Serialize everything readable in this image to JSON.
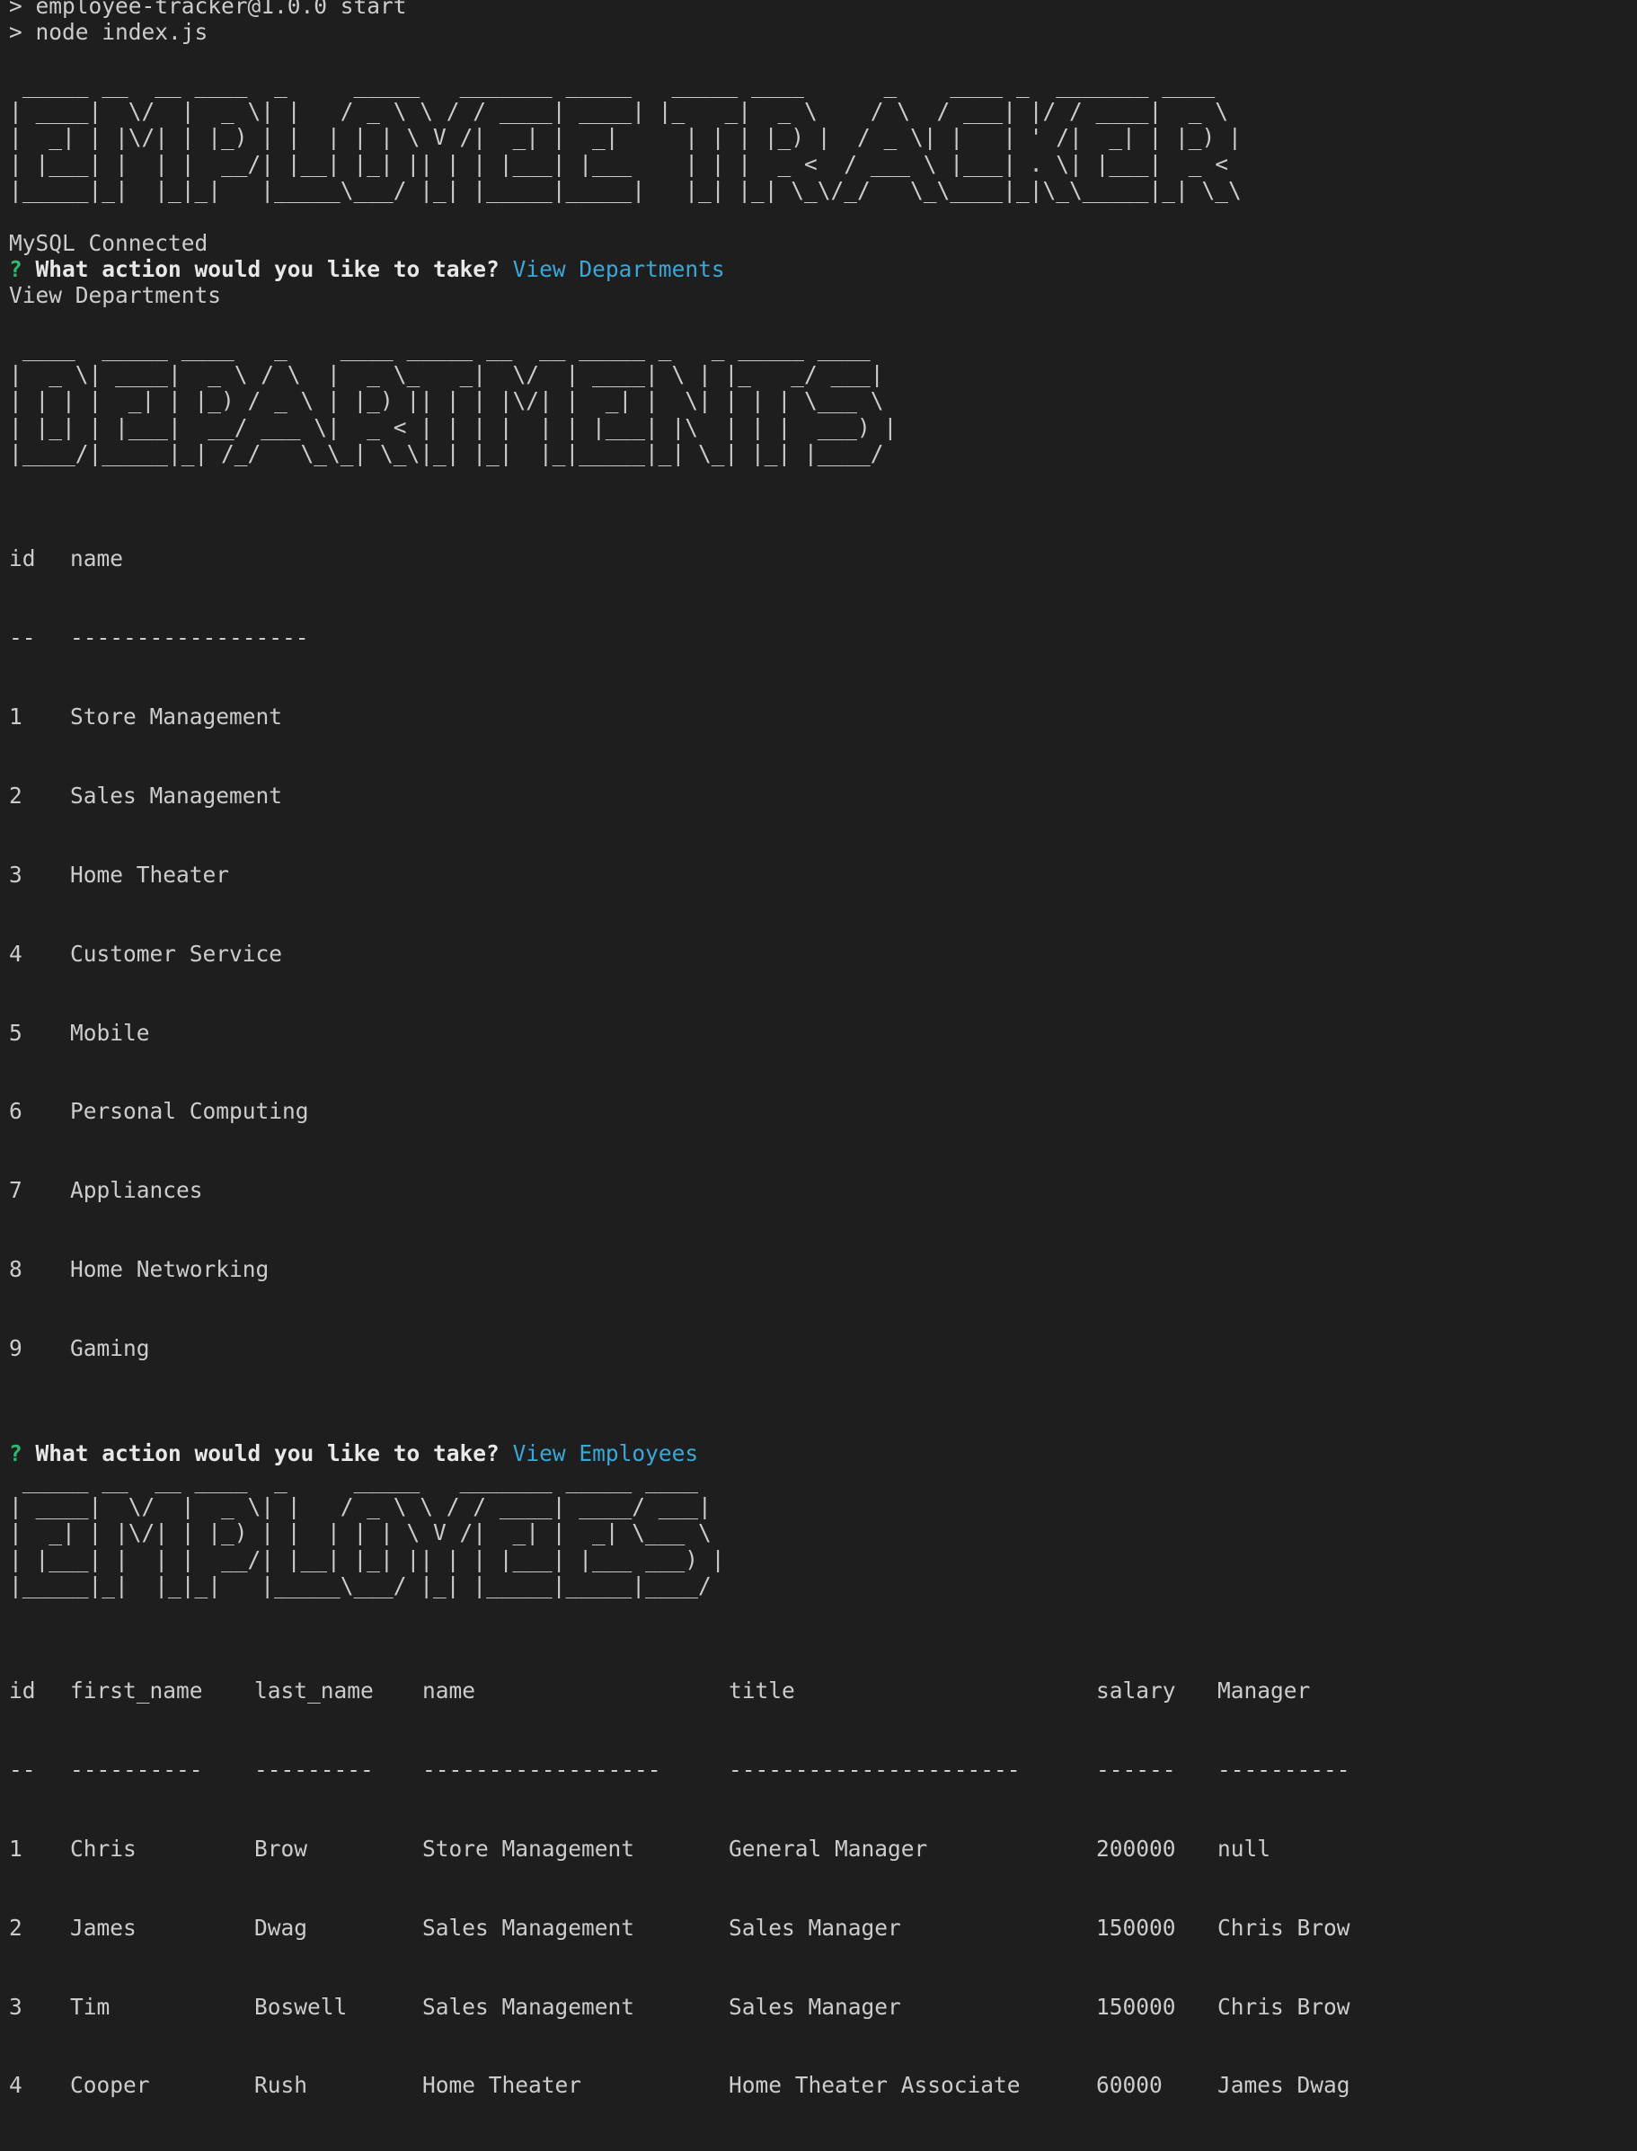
{
  "header_lines": [
    "> employee-tracker@1.0.0 start",
    "> node index.js"
  ],
  "banners": {
    "employee_tracker": " _____ __  __ ____  _     _____   _______ _____   _____ ____      _    ____ _  _______ ____  \n| ____|  \\/  |  _ \\| |   / _ \\ \\ / / ____| ____| |_   _|  _ \\    / \\  / ___| |/ / ____|  _ \\ \n|  _| | |\\/| | |_) | |  | | | \\ V /|  _| |  _|     | | | |_) |  / _ \\| |   | ' /|  _| | |_) |\n| |___| |  | |  __/| |__| |_| || | | |___| |___    | | |  _ <  / ___ \\ |___| . \\| |___|  _ < \n|_____|_|  |_|_|   |_____\\___/ |_| |_____|_____|   |_| |_| \\_\\/_/   \\_\\____|_|\\_\\_____|_| \\_\\",
    "departments": " ____  _____ ____   _    ____ _____ __  __ _____ _   _ _____ ____  \n|  _ \\| ____|  _ \\ / \\  |  _ \\_   _|  \\/  | ____| \\ | |_   _/ ___| \n| | | |  _| | |_) / _ \\ | |_) || | | |\\/| |  _| |  \\| | | | \\___ \\ \n| |_| | |___|  __/ ___ \\|  _ < | | | |  | | |___| |\\  | | |  ___) |\n|____/|_____|_| /_/   \\_\\_| \\_\\|_| |_|  |_|_____|_| \\_| |_| |____/ ",
    "employees": " _____ __  __ ____  _     _____   _______ _____ ____  \n| ____|  \\/  |  _ \\| |   / _ \\ \\ / / ____| ____/ ___| \n|  _| | |\\/| | |_) | |  | | | \\ V /|  _| |  _| \\___ \\ \n| |___| |  | |  __/| |__| |_| || | | |___| |___ ___) |\n|_____|_|  |_|_|   |_____\\___/ |_| |_____|_____|____/ "
  },
  "status": {
    "mysql": "MySQL Connected"
  },
  "prompt1": {
    "mark": "?",
    "question": "What action would you like to take?",
    "answer": "View Departments",
    "echo": "View Departments"
  },
  "prompt2": {
    "mark": "?",
    "question": "What action would you like to take?",
    "answer": "View Employees"
  },
  "departments_table": {
    "headers": [
      "id",
      "name"
    ],
    "dividers": [
      "--",
      "------------------"
    ],
    "rows": [
      [
        "1",
        "Store Management"
      ],
      [
        "2",
        "Sales Management"
      ],
      [
        "3",
        "Home Theater"
      ],
      [
        "4",
        "Customer Service"
      ],
      [
        "5",
        "Mobile"
      ],
      [
        "6",
        "Personal Computing"
      ],
      [
        "7",
        "Appliances"
      ],
      [
        "8",
        "Home Networking"
      ],
      [
        "9",
        "Gaming"
      ]
    ]
  },
  "employees_table": {
    "headers": [
      "id",
      "first_name",
      "last_name",
      "name",
      "title",
      "salary",
      "Manager"
    ],
    "dividers": [
      "--",
      "----------",
      "---------",
      "------------------",
      "----------------------",
      "------",
      "----------"
    ],
    "rows": [
      [
        "1",
        "Chris",
        "Brow",
        "Store Management",
        "General Manager",
        "200000",
        "null"
      ],
      [
        "2",
        "James",
        "Dwag",
        "Sales Management",
        "Sales Manager",
        "150000",
        "Chris Brow"
      ],
      [
        "3",
        "Tim",
        "Boswell",
        "Sales Management",
        "Sales Manager",
        "150000",
        "Chris Brow"
      ],
      [
        "4",
        "Cooper",
        "Rush",
        "Home Theater",
        "Home Theater Associate",
        "60000",
        "James Dwag"
      ]
    ]
  },
  "colors": {
    "background": "#1e1e1e",
    "text": "#cccccc",
    "prompt_mark": "#2fb872",
    "answer": "#3ba7d8"
  }
}
